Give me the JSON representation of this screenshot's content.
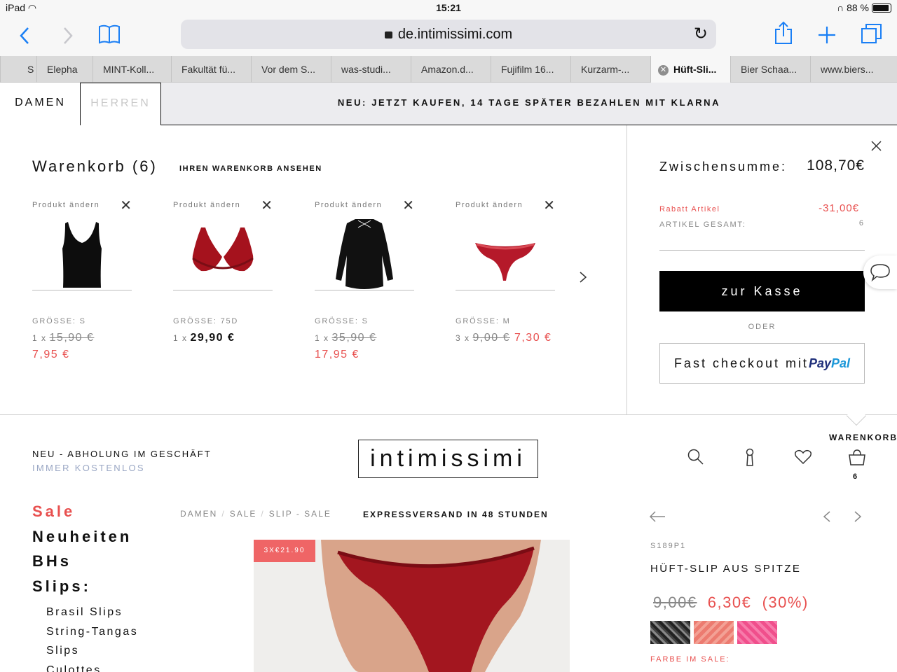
{
  "status": {
    "device": "iPad",
    "time": "15:21",
    "battery": "88 %"
  },
  "browser": {
    "url": "de.intimissimi.com",
    "tabs": [
      {
        "label": "S"
      },
      {
        "label": "Elepha"
      },
      {
        "label": "MINT-Koll..."
      },
      {
        "label": "Fakultät fü..."
      },
      {
        "label": "Vor dem S..."
      },
      {
        "label": "was-studi..."
      },
      {
        "label": "Amazon.d..."
      },
      {
        "label": "Fujifilm 16..."
      },
      {
        "label": "Kurzarm-..."
      },
      {
        "label": "Hüft-Sli..."
      },
      {
        "label": "Bier Schaa..."
      },
      {
        "label": "www.biers..."
      }
    ]
  },
  "site_nav": {
    "damen": "DAMEN",
    "herren": "HERREN",
    "promo": "NEU: JETZT KAUFEN, 14 TAGE SPÄTER BEZAHLEN MIT KLARNA"
  },
  "cart": {
    "title": "Warenkorb (6)",
    "view_link": "IHREN WARENKORB ANSEHEN",
    "edit_label": "Produkt ändern",
    "items": [
      {
        "name": "black-top",
        "size": "GRÖSSE: S",
        "qty": "1 x",
        "old_price": "15,90 €",
        "price": "7,95 €"
      },
      {
        "name": "red-bra",
        "size": "GRÖSSE: 75D",
        "qty": "1 x",
        "old_price": "",
        "price": "29,90 €"
      },
      {
        "name": "black-shirt",
        "size": "GRÖSSE: S",
        "qty": "1 x",
        "old_price": "35,90 €",
        "price": "17,95 €"
      },
      {
        "name": "red-slip",
        "size": "GRÖSSE: M",
        "qty": "3 x",
        "old_price": "9,00 €",
        "price": "7,30 €"
      }
    ],
    "summary": {
      "subtotal_label": "Zwischensumme:",
      "subtotal_value": "108,70€",
      "discount_label": "Rabatt Artikel",
      "discount_value": "-31,00€",
      "total_items_label": "ARTIKEL GESAMT:",
      "total_items_value": "6",
      "checkout_label": "zur Kasse",
      "or_label": "ODER",
      "paypal_label": "Fast checkout mit",
      "paypal_brand_1": "Pay",
      "paypal_brand_2": "Pal"
    }
  },
  "header": {
    "pickup_line1": "NEU - ABHOLUNG IM GESCHÄFT",
    "pickup_line2": "IMMER KOSTENLOS",
    "logo": "intimissimi",
    "cart_label": "WARENKORB",
    "cart_count": "6"
  },
  "menu": {
    "sale": "Sale",
    "neuheiten": "Neuheiten",
    "bhs": "BHs",
    "slips": "Slips:",
    "sub": [
      "Brasil Slips",
      "String-Tangas",
      "Slips",
      "Culottes"
    ]
  },
  "breadcrumb": {
    "a": "DAMEN",
    "b": "SALE",
    "c": "SLIP - SALE"
  },
  "express": "EXPRESSVERSAND IN 48 STUNDEN",
  "product": {
    "badge": "3X€21.90",
    "sku": "S189P1",
    "name": "HÜFT-SLIP AUS SPITZE",
    "old_price": "9,00€",
    "price": "6,30€",
    "discount": "(30%)",
    "color_label": "FARBE IM SALE:"
  },
  "colors": {
    "accent_red": "#e8504f",
    "ios_blue": "#1a7ff5",
    "pickup_blue": "#9aa7c4"
  }
}
